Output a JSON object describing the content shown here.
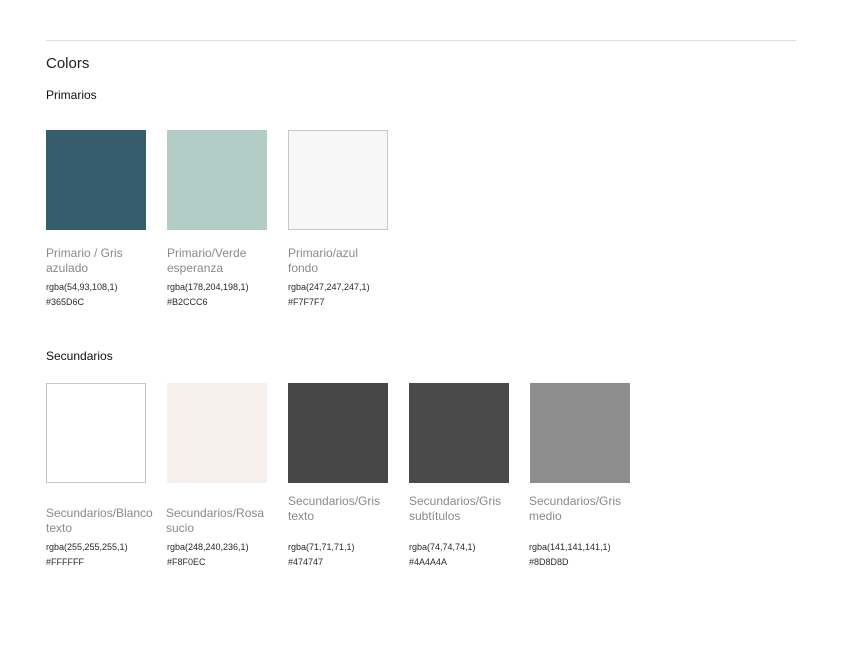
{
  "page": {
    "title": "Colors"
  },
  "sections": {
    "primarios": {
      "title": "Primarios",
      "items": [
        {
          "name": "Primario / Gris azulado",
          "rgba": "rgba(54,93,108,1)",
          "hex": "#365D6C",
          "color": "#365D6C"
        },
        {
          "name": "Primario/Verde esperanza",
          "rgba": "rgba(178,204,198,1)",
          "hex": "#B2CCC6",
          "color": "#B2CCC6"
        },
        {
          "name": "Primario/azul fondo",
          "rgba": "rgba(247,247,247,1)",
          "hex": "#F7F7F7",
          "color": "#F7F7F7"
        }
      ]
    },
    "secundarios": {
      "title": "Secundarios",
      "items": [
        {
          "name": "Secundarios/Blanco texto",
          "rgba": "rgba(255,255,255,1)",
          "hex": "#FFFFFF",
          "color": "#FFFFFF"
        },
        {
          "name": "Secundarios/Rosa sucio",
          "rgba": "rgba(248,240,236,1)",
          "hex": "#F8F0EC",
          "color": "#F8F0EC"
        },
        {
          "name": "Secundarios/Gris texto",
          "rgba": "rgba(71,71,71,1)",
          "hex": "#474747",
          "color": "#474747"
        },
        {
          "name": "Secundarios/Gris subtítulos",
          "rgba": "rgba(74,74,74,1)",
          "hex": "#4A4A4A",
          "color": "#4A4A4A"
        },
        {
          "name": "Secundarios/Gris medio",
          "rgba": "rgba(141,141,141,1)",
          "hex": "#8D8D8D",
          "color": "#8D8D8D"
        }
      ]
    }
  }
}
